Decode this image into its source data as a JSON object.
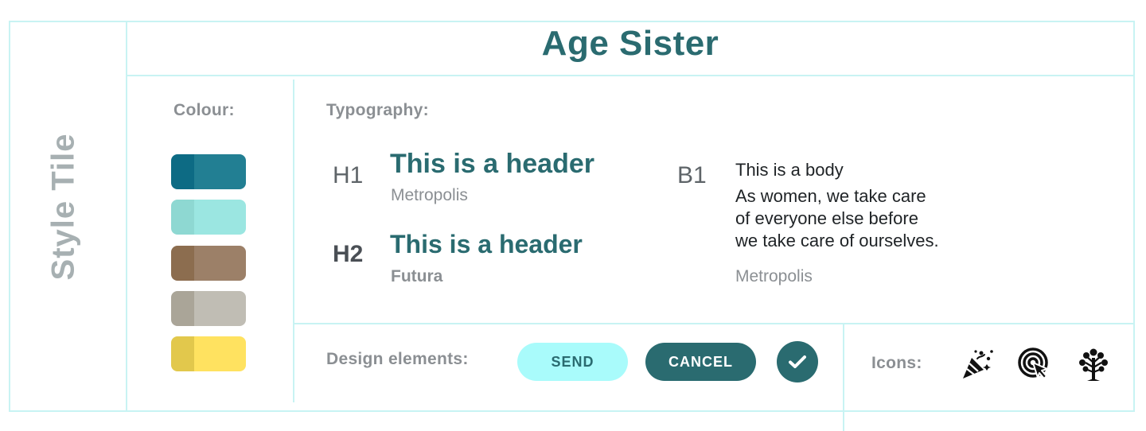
{
  "page": {
    "vertical_title": "Style Tile",
    "title": "Age Sister"
  },
  "colour": {
    "label": "Colour:",
    "swatches": [
      {
        "dark": "#0d6b84",
        "main": "#227f93"
      },
      {
        "dark": "#8ed8d2",
        "main": "#9be6e1"
      },
      {
        "dark": "#8c6d4f",
        "main": "#9c8068"
      },
      {
        "dark": "#aaa598",
        "main": "#c0bdb4"
      },
      {
        "dark": "#e2c84c",
        "main": "#ffe260"
      }
    ]
  },
  "typography": {
    "label": "Typography:",
    "h1": {
      "tag": "H1",
      "sample": "This is a header",
      "font": "Metropolis"
    },
    "h2": {
      "tag": "H2",
      "sample": "This is a header",
      "font": "Futura"
    },
    "b1": {
      "tag": "B1",
      "title": "This is a body",
      "lines": [
        "As women, we take care",
        "of everyone else before",
        "we take care of ourselves."
      ],
      "font": "Metropolis"
    }
  },
  "design_elements": {
    "label": "Design elements:",
    "send_label": "SEND",
    "cancel_label": "CANCEL"
  },
  "icons": {
    "label": "Icons:",
    "items": [
      "party-popper-icon",
      "target-cursor-icon",
      "tree-icon"
    ]
  },
  "colors": {
    "accent": "#2a6b70",
    "light_accent": "#a9fbfb",
    "border": "#c8f3f3",
    "label_gray": "#8b8f93"
  }
}
